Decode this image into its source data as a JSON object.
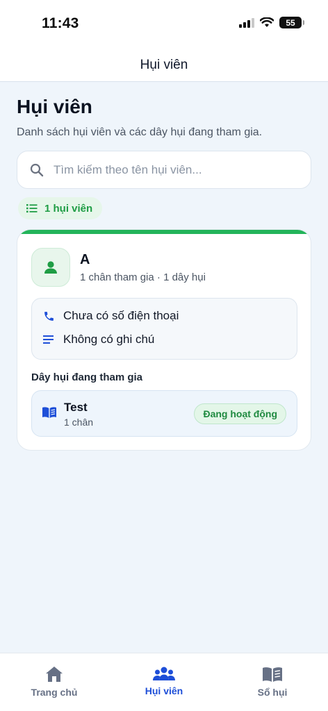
{
  "status_bar": {
    "time": "11:43",
    "battery": "55"
  },
  "nav": {
    "title": "Hụi viên"
  },
  "page": {
    "title": "Hụi viên",
    "subtitle": "Danh sách hụi viên và các dây hụi đang tham gia."
  },
  "search": {
    "placeholder": "Tìm kiếm theo tên hụi viên...",
    "value": ""
  },
  "count_chip": {
    "label": "1 hụi viên"
  },
  "member": {
    "name": "A",
    "meta": "1 chân tham gia · 1 dây hụi",
    "phone": "Chưa có số điện thoại",
    "note": "Không có ghi chú",
    "groups_heading": "Dây hụi đang tham gia",
    "groups": [
      {
        "name": "Test",
        "sub": "1 chân",
        "status": "Đang hoạt động"
      }
    ]
  },
  "tabs": [
    {
      "label": "Trang chủ",
      "icon": "home-icon",
      "active": false
    },
    {
      "label": "Hụi viên",
      "icon": "people-icon",
      "active": true
    },
    {
      "label": "Sổ hụi",
      "icon": "book-icon",
      "active": false
    }
  ],
  "colors": {
    "accent_green": "#23b45a",
    "active_tab": "#1e4fd8",
    "background": "#eff5fb"
  }
}
